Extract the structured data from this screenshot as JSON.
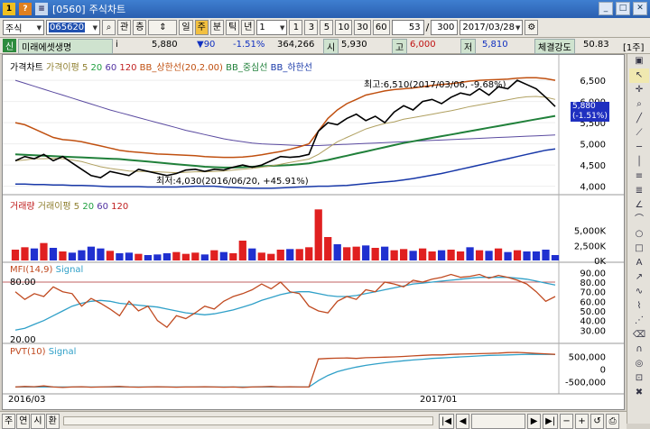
{
  "window": {
    "screen_no": "[0560]",
    "title": "주식차트",
    "icon_labels": [
      "1",
      "?"
    ]
  },
  "toolbar": {
    "market": "주식",
    "code": "065620",
    "btn_a": "관",
    "btn_b": "층",
    "periods": [
      "일",
      "주",
      "분",
      "틱",
      "년"
    ],
    "active_period": "주",
    "minutes": [
      "1",
      "3",
      "5",
      "10",
      "30",
      "60"
    ],
    "count": "53",
    "total": "300",
    "date": "2017/03/28"
  },
  "info": {
    "name": "미래에셋생명",
    "price": "5,880",
    "change": "▼90",
    "rate": "-1.51%",
    "volume": "364,266",
    "open_label": "시",
    "open": "5,930",
    "high_label": "고",
    "high": "6,000",
    "low_label": "저",
    "low": "5,810",
    "strength_label": "체결강도",
    "strength": "50.83",
    "unit": "[1주]"
  },
  "colors": {
    "up": "#e02020",
    "down": "#2030d0",
    "price": "#000000",
    "bb_upper": "#c05010",
    "bb_mid": "#20803a",
    "bb_lower": "#1838a8",
    "mfi": "#c04a20",
    "signal": "#30a0c8"
  },
  "price_panel": {
    "legend": [
      "가격차트",
      "가격이평 5",
      "20",
      "60",
      "120",
      "BB_상한선(20,2.00)",
      "BB_중심선",
      "BB_하한선"
    ],
    "max_label": "최고:6,510(2017/03/06, -9.68%)",
    "min_label": "최저:4,030(2016/06/20, +45.91%)",
    "price_tag": "5,880",
    "price_tag_rate": "(-1.51%)",
    "y_ticks": [
      "6,500",
      "6,000",
      "5,500",
      "5,000",
      "4,500",
      "4,000"
    ]
  },
  "volume_panel": {
    "legend": [
      "거래량",
      "거래이평 5",
      "20",
      "60",
      "120"
    ],
    "y_ticks": [
      "5,000K",
      "2,500K",
      "0K"
    ]
  },
  "mfi_panel": {
    "legend": [
      "MFI(14,9)",
      "Signal"
    ],
    "level_hi": "80.00",
    "level_lo": "20.00",
    "y_ticks": [
      "90.00",
      "80.00",
      "70.00",
      "60.00",
      "50.00",
      "40.00",
      "30.00"
    ]
  },
  "pvt_panel": {
    "legend": [
      "PVT(10)",
      "Signal"
    ],
    "y_ticks": [
      "500,000",
      "0",
      "-500,000"
    ]
  },
  "x_axis": {
    "labels": [
      "2016/03",
      "2017/01"
    ]
  },
  "bottom": {
    "tabs": [
      "주",
      "연",
      "시",
      "환"
    ]
  },
  "chart_data": {
    "type": "line",
    "price": [
      4600,
      4700,
      4650,
      4750,
      4600,
      4700,
      4550,
      4400,
      4250,
      4200,
      4350,
      4300,
      4250,
      4400,
      4350,
      4300,
      4250,
      4300,
      4380,
      4400,
      4350,
      4400,
      4380,
      4450,
      4500,
      4450,
      4500,
      4600,
      4700,
      4680,
      4700,
      4750,
      5300,
      5500,
      5450,
      5600,
      5700,
      5550,
      5650,
      5500,
      5750,
      5900,
      5800,
      6000,
      6050,
      5950,
      6100,
      6200,
      6150,
      6300,
      6150,
      6350,
      6300,
      6500,
      6400,
      6300,
      6100,
      5880
    ],
    "ma20": [
      4600,
      4620,
      4650,
      4650,
      4660,
      4650,
      4620,
      4580,
      4520,
      4460,
      4420,
      4390,
      4360,
      4350,
      4350,
      4340,
      4330,
      4320,
      4330,
      4340,
      4340,
      4350,
      4360,
      4380,
      4400,
      4420,
      4450,
      4480,
      4520,
      4560,
      4600,
      4640,
      4750,
      4900,
      5050,
      5150,
      5250,
      5350,
      5420,
      5480,
      5520,
      5580,
      5620,
      5660,
      5700,
      5740,
      5780,
      5830,
      5880,
      5920,
      5960,
      6000,
      6040,
      6080,
      6110,
      6120,
      6100,
      6050
    ],
    "bb_upper": [
      5500,
      5450,
      5350,
      5250,
      5150,
      5100,
      5080,
      5050,
      5000,
      4950,
      4900,
      4850,
      4820,
      4800,
      4780,
      4760,
      4750,
      4740,
      4730,
      4720,
      4700,
      4690,
      4680,
      4680,
      4690,
      4710,
      4740,
      4780,
      4820,
      4870,
      4930,
      5000,
      5300,
      5600,
      5800,
      5950,
      6050,
      6150,
      6200,
      6250,
      6280,
      6300,
      6320,
      6350,
      6380,
      6400,
      6420,
      6450,
      6480,
      6500,
      6510,
      6520,
      6530,
      6550,
      6560,
      6560,
      6540,
      6500
    ],
    "bb_mid": [
      4750,
      4740,
      4730,
      4720,
      4710,
      4700,
      4690,
      4680,
      4670,
      4660,
      4650,
      4640,
      4620,
      4600,
      4580,
      4560,
      4540,
      4520,
      4500,
      4480,
      4460,
      4450,
      4440,
      4440,
      4450,
      4460,
      4470,
      4480,
      4490,
      4500,
      4520,
      4540,
      4580,
      4620,
      4670,
      4720,
      4770,
      4820,
      4870,
      4920,
      4970,
      5020,
      5060,
      5100,
      5140,
      5180,
      5220,
      5260,
      5300,
      5340,
      5380,
      5420,
      5460,
      5500,
      5540,
      5580,
      5620,
      5660
    ],
    "bb_lower": [
      4050,
      4050,
      4040,
      4040,
      4030,
      4030,
      4020,
      4020,
      4010,
      4000,
      3990,
      3990,
      3990,
      3990,
      3980,
      3980,
      3980,
      3980,
      3990,
      4000,
      4000,
      4000,
      3980,
      3970,
      3960,
      3950,
      3950,
      3950,
      3960,
      3970,
      3980,
      3990,
      4000,
      4000,
      4010,
      4020,
      4040,
      4060,
      4080,
      4100,
      4120,
      4150,
      4180,
      4220,
      4260,
      4300,
      4350,
      4400,
      4450,
      4500,
      4550,
      4600,
      4650,
      4700,
      4750,
      4800,
      4850,
      4880
    ],
    "ma60": [
      6500,
      6430,
      6360,
      6290,
      6220,
      6150,
      6080,
      6010,
      5940,
      5870,
      5800,
      5740,
      5680,
      5620,
      5560,
      5500,
      5440,
      5380,
      5320,
      5270,
      5220,
      5170,
      5120,
      5080,
      5050,
      5020,
      5000,
      4990,
      4980,
      4970,
      4960,
      4960,
      4960,
      4970,
      4980,
      4990,
      5000,
      5010,
      5020,
      5030,
      5040,
      5050,
      5060,
      5070,
      5080,
      5090,
      5100,
      5110,
      5120,
      5130,
      5140,
      5150,
      5160,
      5170,
      5180,
      5190,
      5200,
      5210
    ],
    "volume_k": [
      1800,
      2200,
      2000,
      2900,
      2100,
      1500,
      1300,
      1700,
      2300,
      2000,
      1600,
      1200,
      1300,
      1100,
      900,
      1000,
      1200,
      1400,
      1100,
      1300,
      1000,
      1700,
      1400,
      1200,
      3300,
      2000,
      1300,
      1100,
      1800,
      1900,
      1900,
      2200,
      8500,
      3900,
      2700,
      2200,
      2300,
      2500,
      2100,
      2300,
      1700,
      1900,
      1600,
      2000,
      1500,
      1700,
      1800,
      1500,
      2200,
      1700,
      1600,
      2000,
      1400,
      1700,
      1500,
      1500,
      1800,
      900
    ],
    "mfi": [
      70,
      62,
      68,
      65,
      75,
      70,
      68,
      55,
      63,
      58,
      52,
      45,
      60,
      50,
      55,
      40,
      33,
      45,
      42,
      48,
      55,
      52,
      60,
      65,
      68,
      72,
      78,
      73,
      80,
      70,
      68,
      55,
      50,
      48,
      60,
      65,
      62,
      72,
      70,
      80,
      78,
      75,
      82,
      80,
      83,
      85,
      88,
      85,
      86,
      88,
      84,
      87,
      85,
      82,
      78,
      70,
      60,
      65
    ],
    "signal": [
      30,
      32,
      36,
      40,
      45,
      50,
      55,
      58,
      60,
      61,
      60,
      58,
      57,
      56,
      55,
      54,
      52,
      50,
      48,
      47,
      46,
      47,
      49,
      51,
      54,
      57,
      61,
      64,
      67,
      69,
      70,
      70,
      68,
      66,
      65,
      65,
      66,
      68,
      70,
      72,
      74,
      76,
      78,
      79,
      80,
      81,
      82,
      83,
      84,
      85,
      85,
      85,
      85,
      84,
      83,
      81,
      79,
      77
    ],
    "pvt": [
      -700,
      -680,
      -690,
      -660,
      -700,
      -720,
      -700,
      -690,
      -710,
      -700,
      -690,
      -680,
      -700,
      -710,
      -700,
      -690,
      -700,
      -710,
      -700,
      -700,
      -690,
      -700,
      -710,
      -700,
      -720,
      -700,
      -690,
      -680,
      -700,
      -690,
      -700,
      -700,
      400,
      420,
      430,
      440,
      420,
      450,
      460,
      470,
      480,
      500,
      520,
      540,
      560,
      560,
      580,
      590,
      600,
      610,
      620,
      630,
      650,
      660,
      640,
      620,
      600,
      580
    ],
    "pvt_signal": [
      -700,
      -700,
      -700,
      -700,
      -700,
      -700,
      -700,
      -700,
      -700,
      -700,
      -700,
      -700,
      -700,
      -700,
      -700,
      -700,
      -700,
      -700,
      -700,
      -700,
      -700,
      -700,
      -700,
      -700,
      -700,
      -700,
      -700,
      -700,
      -700,
      -700,
      -700,
      -700,
      -450,
      -250,
      -100,
      0,
      80,
      150,
      200,
      250,
      290,
      330,
      360,
      390,
      420,
      440,
      460,
      480,
      500,
      520,
      540,
      550,
      560,
      570,
      580,
      580,
      580,
      580
    ]
  }
}
